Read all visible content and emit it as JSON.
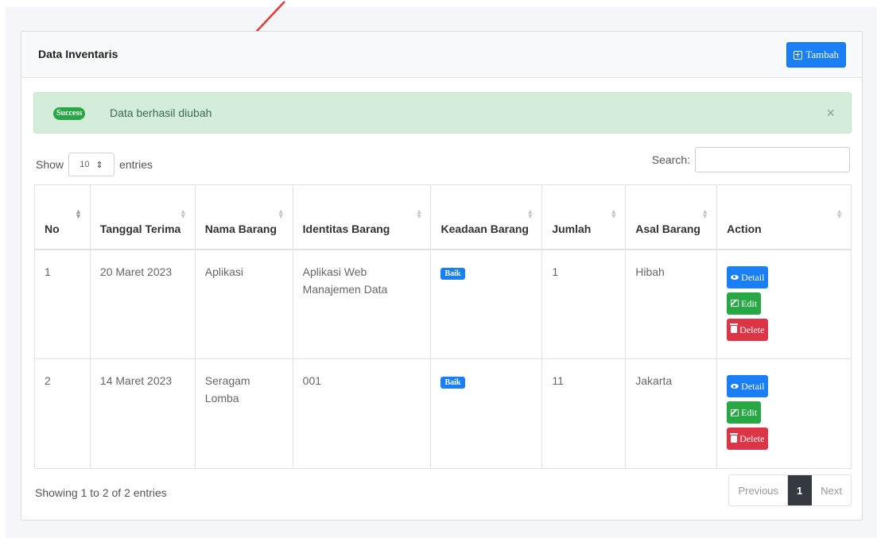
{
  "card": {
    "title": "Data Inventaris",
    "add_button": "Tambah"
  },
  "alert": {
    "badge": "Success",
    "message": "Data berhasil diubah",
    "close": "×"
  },
  "length_menu": {
    "show": "Show",
    "value": "10",
    "entries": "entries"
  },
  "search": {
    "label": "Search:",
    "value": ""
  },
  "table": {
    "headers": [
      "No",
      "Tanggal Terima",
      "Nama Barang",
      "Identitas Barang",
      "Keadaan Barang",
      "Jumlah",
      "Asal Barang",
      "Action"
    ],
    "rows": [
      {
        "no": "1",
        "tanggal": "20 Maret 2023",
        "nama": "Aplikasi",
        "identitas": "Aplikasi Web Manajemen Data",
        "keadaan": "Baik",
        "jumlah": "1",
        "asal": "Hibah"
      },
      {
        "no": "2",
        "tanggal": "14 Maret 2023",
        "nama": "Seragam Lomba",
        "identitas": "001",
        "keadaan": "Baik",
        "jumlah": "11",
        "asal": "Jakarta"
      }
    ],
    "actions": {
      "detail": "Detail",
      "edit": "Edit",
      "delete": "Delete"
    }
  },
  "footer": {
    "info": "Showing 1 to 2 of 2 entries",
    "previous": "Previous",
    "page": "1",
    "next": "Next"
  },
  "colors": {
    "primary": "#1a7ff6",
    "success": "#28a745",
    "danger": "#dc3545",
    "alert_bg": "#d4edda",
    "annotation_arrow": "#e53935"
  }
}
